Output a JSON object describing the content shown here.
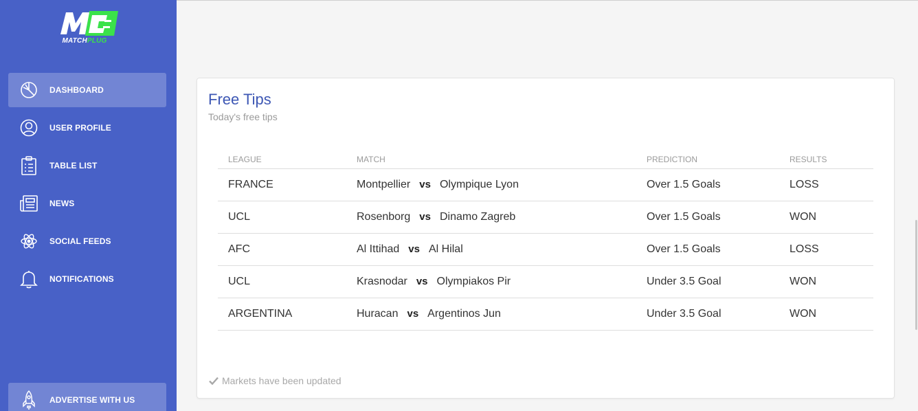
{
  "brand": {
    "logo_letters": "M",
    "name_part1": "MATCH",
    "name_part2": "PLUG",
    "accent_color": "#3be24a"
  },
  "sidebar": {
    "background": "#4861c7",
    "items": [
      {
        "label": "DASHBOARD",
        "icon": "pie-chart-icon",
        "active": true
      },
      {
        "label": "USER PROFILE",
        "icon": "user-icon",
        "active": false
      },
      {
        "label": "TABLE LIST",
        "icon": "clipboard-icon",
        "active": false
      },
      {
        "label": "NEWS",
        "icon": "newspaper-icon",
        "active": false
      },
      {
        "label": "SOCIAL FEEDS",
        "icon": "atom-icon",
        "active": false
      },
      {
        "label": "NOTIFICATIONS",
        "icon": "bell-icon",
        "active": false
      }
    ],
    "bottom_item": {
      "label": "ADVERTISE WITH US",
      "icon": "rocket-icon"
    }
  },
  "card": {
    "title": "Free Tips",
    "subtitle": "Today's free tips",
    "columns": [
      "LEAGUE",
      "MATCH",
      "PREDICTION",
      "RESULTS"
    ],
    "rows": [
      {
        "league": "FRANCE",
        "home": "Montpellier",
        "vs": "vs",
        "away": "Olympique Lyon",
        "prediction": "Over 1.5 Goals",
        "result": "LOSS"
      },
      {
        "league": "UCL",
        "home": "Rosenborg",
        "vs": "vs",
        "away": "Dinamo Zagreb",
        "prediction": "Over 1.5 Goals",
        "result": "WON"
      },
      {
        "league": "AFC",
        "home": "Al Ittihad",
        "vs": "vs",
        "away": "Al Hilal",
        "prediction": "Over 1.5 Goals",
        "result": "LOSS"
      },
      {
        "league": "UCL",
        "home": "Krasnodar",
        "vs": "vs",
        "away": "Olympiakos Pir",
        "prediction": "Under 3.5 Goal",
        "result": "WON"
      },
      {
        "league": "ARGENTINA",
        "home": "Huracan",
        "vs": "vs",
        "away": "Argentinos Jun",
        "prediction": "Under 3.5 Goal",
        "result": "WON"
      }
    ],
    "footer": "Markets have been updated"
  }
}
